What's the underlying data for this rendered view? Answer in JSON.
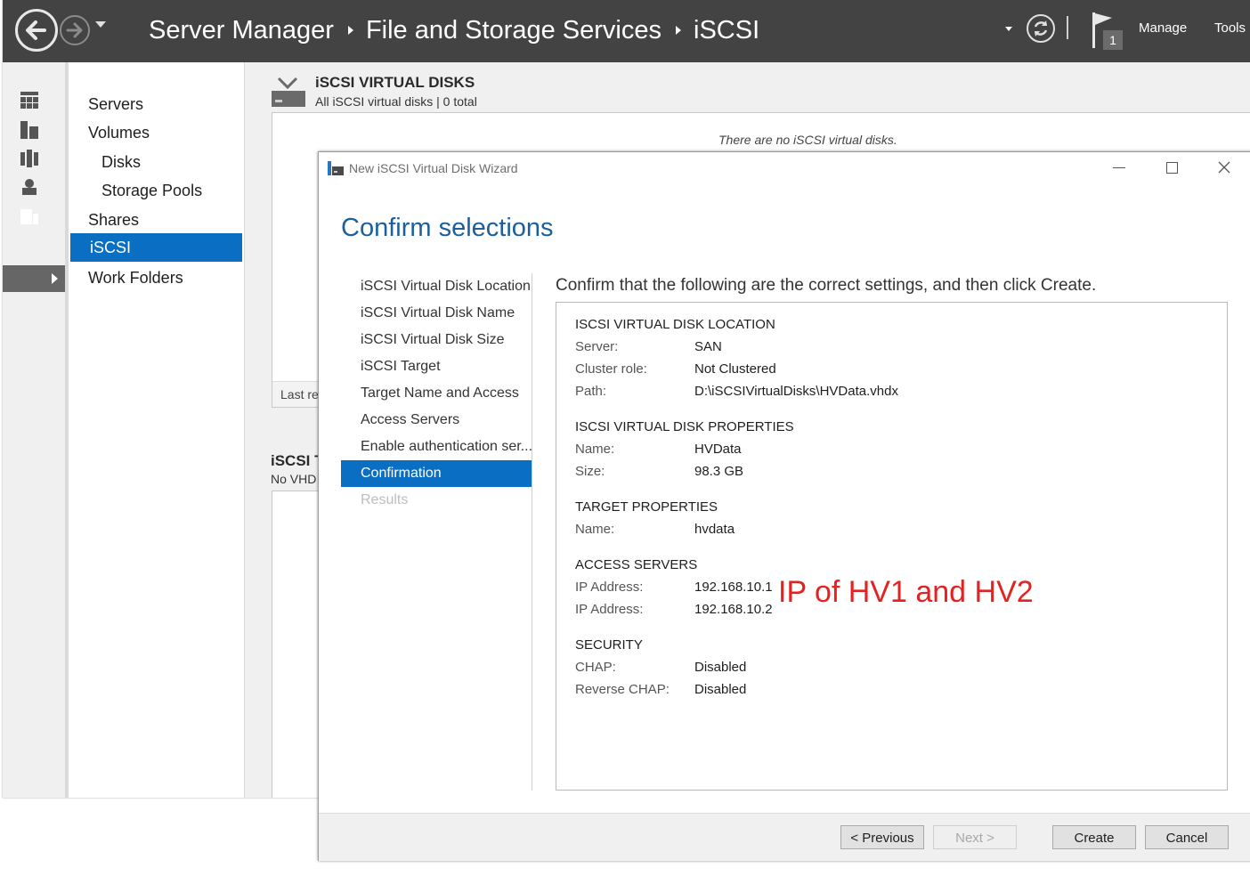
{
  "window": {
    "breadcrumb": [
      "Server Manager",
      "File and Storage Services",
      "iSCSI"
    ],
    "notification_count": "1",
    "menus": [
      "Manage",
      "Tools"
    ]
  },
  "nav": {
    "items": [
      {
        "label": "Servers",
        "level": 0
      },
      {
        "label": "Volumes",
        "level": 0
      },
      {
        "label": "Disks",
        "level": 1
      },
      {
        "label": "Storage Pools",
        "level": 1
      },
      {
        "label": "Shares",
        "level": 0
      },
      {
        "label": "iSCSI",
        "level": 0,
        "selected": true
      },
      {
        "label": "Work Folders",
        "level": 0
      }
    ]
  },
  "virtual_disks": {
    "title": "iSCSI VIRTUAL DISKS",
    "subtitle": "All iSCSI virtual disks | 0 total",
    "empty_text": "There are no iSCSI virtual disks.",
    "footer_text": "Last re"
  },
  "targets": {
    "title": "iSCSI T",
    "subtitle": "No VHD"
  },
  "wizard": {
    "title": "New iSCSI Virtual Disk Wizard",
    "heading": "Confirm selections",
    "steps": [
      {
        "label": "iSCSI Virtual Disk Location"
      },
      {
        "label": "iSCSI Virtual Disk Name"
      },
      {
        "label": "iSCSI Virtual Disk Size"
      },
      {
        "label": "iSCSI Target"
      },
      {
        "label": "Target Name and Access"
      },
      {
        "label": "Access Servers"
      },
      {
        "label": "Enable authentication ser..."
      },
      {
        "label": "Confirmation",
        "state": "active"
      },
      {
        "label": "Results",
        "state": "disabled"
      }
    ],
    "intro": "Confirm that the following are the correct settings, and then click Create.",
    "sections": {
      "location": {
        "heading": "ISCSI VIRTUAL DISK LOCATION",
        "server_label": "Server:",
        "server": "SAN",
        "cluster_label": "Cluster role:",
        "cluster": "Not Clustered",
        "path_label": "Path:",
        "path": "D:\\iSCSIVirtualDisks\\HVData.vhdx"
      },
      "properties": {
        "heading": "ISCSI VIRTUAL DISK PROPERTIES",
        "name_label": "Name:",
        "name": "HVData",
        "size_label": "Size:",
        "size": "98.3 GB"
      },
      "target": {
        "heading": "TARGET PROPERTIES",
        "name_label": "Name:",
        "name": "hvdata"
      },
      "access": {
        "heading": "ACCESS SERVERS",
        "ip1_label": "IP Address:",
        "ip1": "192.168.10.1",
        "ip2_label": "IP Address:",
        "ip2": "192.168.10.2"
      },
      "security": {
        "heading": "SECURITY",
        "chap_label": "CHAP:",
        "chap": "Disabled",
        "rchap_label": "Reverse CHAP:",
        "rchap": "Disabled"
      }
    },
    "annotation": "IP of HV1 and HV2",
    "buttons": {
      "previous": "< Previous",
      "next": "Next >",
      "create": "Create",
      "cancel": "Cancel"
    }
  },
  "colors": {
    "titlebar": "#434343",
    "selection": "#0a6fc2",
    "heading": "#1a5f9e",
    "annotation": "#e52222"
  }
}
